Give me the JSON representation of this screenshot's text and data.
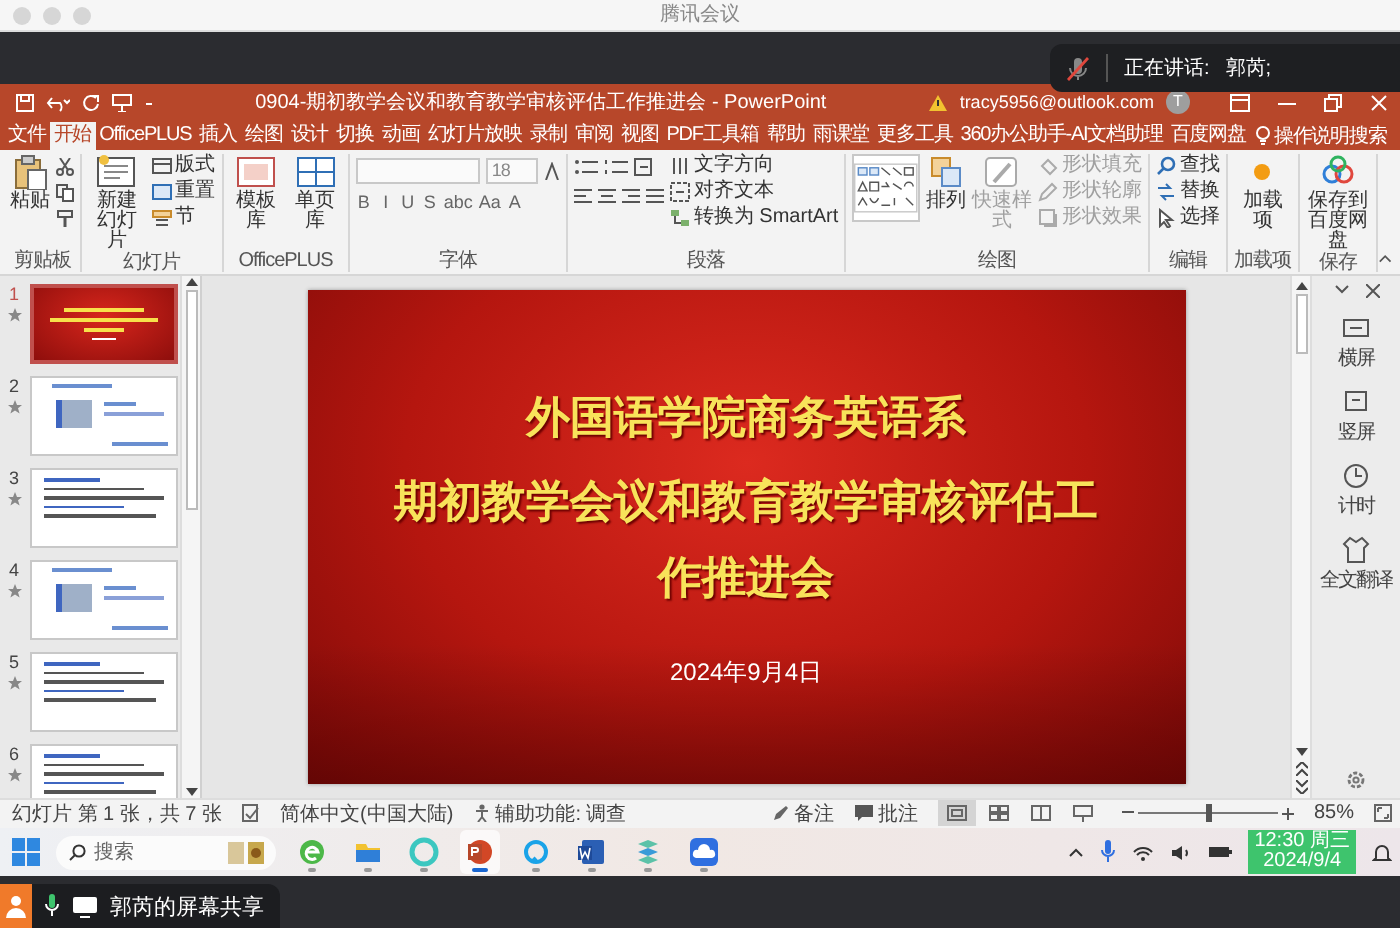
{
  "meeting": {
    "title": "腾讯会议",
    "speaker_label": "正在讲话:",
    "speaker_name": "郭芮;",
    "mic_muted": true
  },
  "ppt": {
    "title": "0904-期初教学会议和教育教学审核评估工作推进会 - PowerPoint",
    "account": "tracy5956@outlook.com",
    "avatar": "T"
  },
  "tabs": [
    {
      "label": "文件",
      "selected": false
    },
    {
      "label": "开始",
      "selected": true
    },
    {
      "label": "OfficePLUS",
      "selected": false
    },
    {
      "label": "插入",
      "selected": false
    },
    {
      "label": "绘图",
      "selected": false
    },
    {
      "label": "设计",
      "selected": false
    },
    {
      "label": "切换",
      "selected": false
    },
    {
      "label": "动画",
      "selected": false
    },
    {
      "label": "幻灯片放映",
      "selected": false
    },
    {
      "label": "录制",
      "selected": false
    },
    {
      "label": "审阅",
      "selected": false
    },
    {
      "label": "视图",
      "selected": false
    },
    {
      "label": "PDF工具箱",
      "selected": false
    },
    {
      "label": "帮助",
      "selected": false
    },
    {
      "label": "雨课堂",
      "selected": false
    },
    {
      "label": "更多工具",
      "selected": false
    },
    {
      "label": "360办公助手-AI文档助理",
      "selected": false
    },
    {
      "label": "百度网盘",
      "selected": false
    }
  ],
  "tell_me": "操作说明搜索",
  "ribbon": [
    {
      "label": "剪贴板",
      "items": [
        {
          "kind": "big",
          "label": "粘贴",
          "disabled": false
        },
        {
          "kind": "tools"
        }
      ]
    },
    {
      "label": "幻灯片",
      "items": [
        {
          "kind": "big",
          "label": "新建幻灯片",
          "disabled": false
        },
        {
          "kind": "small",
          "label": "版式",
          "disabled": false
        },
        {
          "kind": "small",
          "label": "重置",
          "disabled": false
        },
        {
          "kind": "small",
          "label": "节",
          "disabled": false
        }
      ]
    },
    {
      "label": "OfficePLUS",
      "items": [
        {
          "kind": "big",
          "label": "模板库",
          "disabled": false
        },
        {
          "kind": "big",
          "label": "单页库",
          "disabled": false
        }
      ]
    },
    {
      "label": "字体",
      "items": [
        {
          "kind": "font",
          "size": "18",
          "glyphs": [
            "B",
            "I",
            "U",
            "S",
            "abc",
            "Aa",
            "A"
          ]
        }
      ]
    },
    {
      "label": "段落",
      "items": [
        {
          "kind": "lists"
        },
        {
          "kind": "small",
          "label": "文字方向",
          "disabled": false
        },
        {
          "kind": "small",
          "label": "对齐文本",
          "disabled": false
        },
        {
          "kind": "small",
          "label": "转换为 SmartArt",
          "disabled": false
        }
      ]
    },
    {
      "label": "绘图",
      "items": [
        {
          "kind": "shapes"
        },
        {
          "kind": "big",
          "label": "排列",
          "disabled": false
        },
        {
          "kind": "big",
          "label": "快速样式",
          "disabled": true
        },
        {
          "kind": "small",
          "label": "形状填充",
          "disabled": true
        },
        {
          "kind": "small",
          "label": "形状轮廓",
          "disabled": true
        },
        {
          "kind": "small",
          "label": "形状效果",
          "disabled": true
        }
      ]
    },
    {
      "label": "编辑",
      "items": [
        {
          "kind": "small",
          "label": "查找",
          "disabled": false
        },
        {
          "kind": "small",
          "label": "替换",
          "disabled": false
        },
        {
          "kind": "small",
          "label": "选择",
          "disabled": false
        }
      ]
    },
    {
      "label": "加载项",
      "items": [
        {
          "kind": "big",
          "label": "加载项",
          "disabled": false
        }
      ]
    },
    {
      "label": "保存",
      "items": [
        {
          "kind": "big",
          "label": "保存到百度网盘",
          "disabled": false
        }
      ]
    }
  ],
  "thumbnails": [
    {
      "number": "1",
      "kind": "title",
      "selected": true
    },
    {
      "number": "2",
      "kind": "section",
      "selected": false
    },
    {
      "number": "3",
      "kind": "text",
      "selected": false
    },
    {
      "number": "4",
      "kind": "section",
      "selected": false
    },
    {
      "number": "5",
      "kind": "text",
      "selected": false
    },
    {
      "number": "6",
      "kind": "text",
      "selected": false
    }
  ],
  "slide": {
    "title": "外国语学院商务英语系",
    "subtitle": "期初教学会议和教育教学审核评估工作推进会",
    "date": "2024年9月4日"
  },
  "side_panel": [
    {
      "label": "横屏"
    },
    {
      "label": "竖屏"
    },
    {
      "label": "计时"
    },
    {
      "label": "全文翻译"
    }
  ],
  "status_bar": {
    "slide_info": "幻灯片 第 1 张，共 7 张",
    "language": "简体中文(中国大陆)",
    "accessibility": "辅助功能: 调查",
    "notes": "备注",
    "comments": "批注",
    "views": [
      {
        "kind": "normal",
        "selected": true
      },
      {
        "kind": "sorter",
        "selected": false
      },
      {
        "kind": "reading",
        "selected": false
      },
      {
        "kind": "show",
        "selected": false
      }
    ],
    "zoom": {
      "level": 0.5,
      "reading": "85%"
    }
  },
  "taskbar": {
    "search": {
      "placeholder": "搜索"
    },
    "apps": [
      {
        "kind": "edge",
        "selected": false
      },
      {
        "kind": "folder",
        "selected": false
      },
      {
        "kind": "ring",
        "selected": false
      },
      {
        "kind": "powerpoint",
        "selected": true
      },
      {
        "kind": "chat",
        "selected": false
      },
      {
        "kind": "word",
        "selected": false
      },
      {
        "kind": "stack",
        "selected": false
      },
      {
        "kind": "cloud",
        "selected": false
      }
    ],
    "time": "12:30 周三",
    "date": "2024/9/4"
  },
  "share_bar": {
    "label": "郭芮的屏幕共享"
  }
}
